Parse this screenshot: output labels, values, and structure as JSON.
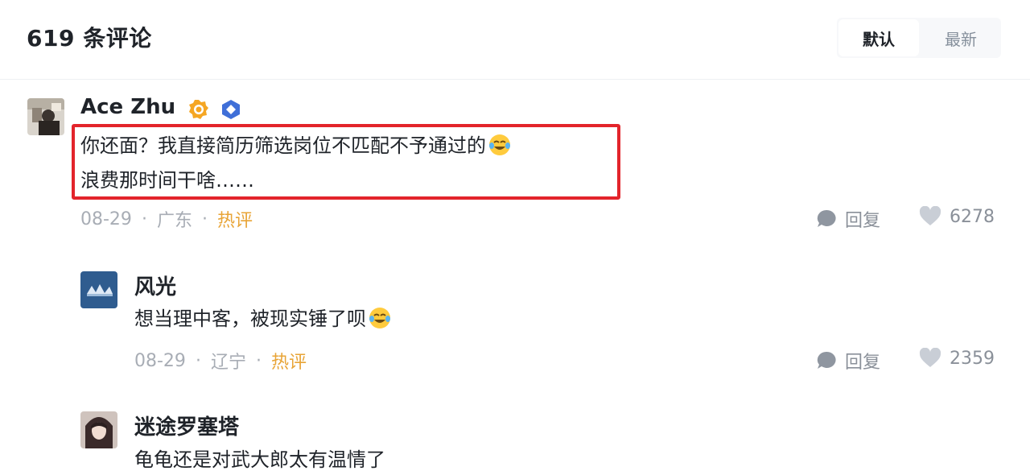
{
  "header": {
    "title": "619 条评论",
    "sort_default": "默认",
    "sort_latest": "最新"
  },
  "comments": [
    {
      "username": "Ace Zhu",
      "line1": "你还面？我直接简历筛选岗位不匹配不予通过的",
      "line2": "浪费那时间干啥……",
      "date": "08-29",
      "location": "广东",
      "tag": "热评",
      "reply_label": "回复",
      "likes": "6278"
    },
    {
      "username": "风光",
      "line1": "想当理中客，被现实锤了呗",
      "date": "08-29",
      "location": "辽宁",
      "tag": "热评",
      "reply_label": "回复",
      "likes": "2359"
    },
    {
      "username": "迷途罗塞塔",
      "line1": "龟龟还是对武大郎太有温情了"
    }
  ],
  "separator": "·",
  "icons": {
    "reply": "comment-bubble-icon",
    "like": "heart-icon",
    "emoji": "laughing-crying-emoji-icon",
    "badge_orange": "orange-verified-badge-icon",
    "badge_blue": "blue-level-badge-icon"
  },
  "colors": {
    "highlight": "#e3242b",
    "hot_tag": "#e8a436"
  }
}
